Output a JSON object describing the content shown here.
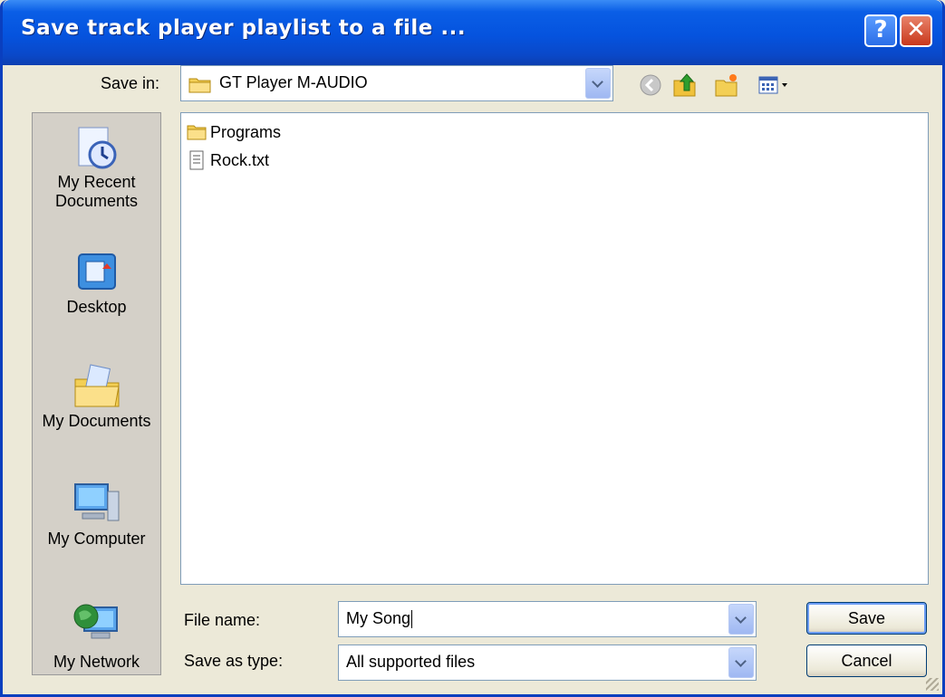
{
  "window": {
    "title": "Save track player playlist to a file ...",
    "help_label": "?",
    "close_label": "✕"
  },
  "save_in": {
    "label": "Save in:",
    "value": "GT Player M-AUDIO"
  },
  "toolbar": {
    "back": "back-icon",
    "up": "up-folder-icon",
    "new_folder": "new-folder-icon",
    "views": "views-menu-icon"
  },
  "places": [
    {
      "label_line1": "My Recent",
      "label_line2": "Documents"
    },
    {
      "label_line1": "Desktop"
    },
    {
      "label_line1": "My Documents"
    },
    {
      "label_line1": "My Computer"
    },
    {
      "label_line1": "My Network"
    }
  ],
  "files": [
    {
      "name": "Programs",
      "kind": "folder"
    },
    {
      "name": "Rock.txt",
      "kind": "text-file"
    }
  ],
  "file_name": {
    "label": "File name:",
    "value": "My Song"
  },
  "save_as_type": {
    "label": "Save as type:",
    "value": "All supported files"
  },
  "buttons": {
    "save": "Save",
    "cancel": "Cancel"
  },
  "colors": {
    "titlebar": "#0553de",
    "dialog_bg": "#ece9d8",
    "close_button": "#c9381c"
  }
}
